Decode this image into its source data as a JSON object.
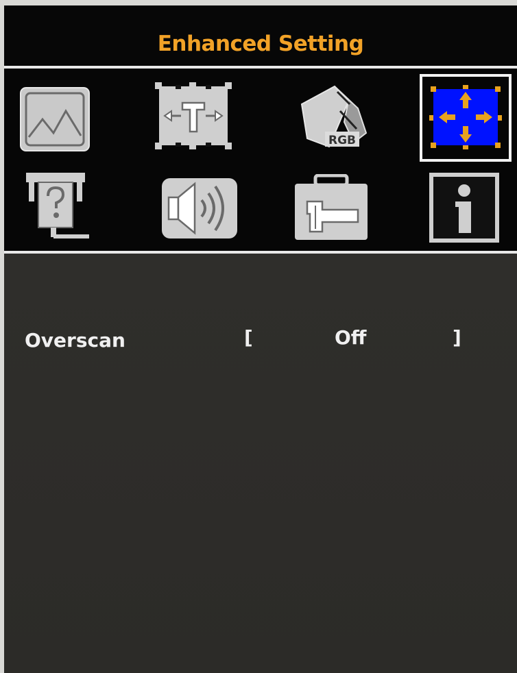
{
  "menu": {
    "title": "Enhanced Setting",
    "selected_index": 3,
    "icons": [
      {
        "name": "picture-icon"
      },
      {
        "name": "image-position-icon"
      },
      {
        "name": "color-rgb-icon",
        "badge": "RGB"
      },
      {
        "name": "enhanced-setting-icon"
      },
      {
        "name": "input-select-icon"
      },
      {
        "name": "audio-icon"
      },
      {
        "name": "setup-icon"
      },
      {
        "name": "information-icon"
      }
    ]
  },
  "settings": [
    {
      "label": "Overscan",
      "open_bracket": "[",
      "value": "Off",
      "close_bracket": "]"
    }
  ],
  "colors": {
    "accent": "#f2a227",
    "selected_bg": "#0012ff",
    "icon_fill": "#c9c9c9"
  }
}
